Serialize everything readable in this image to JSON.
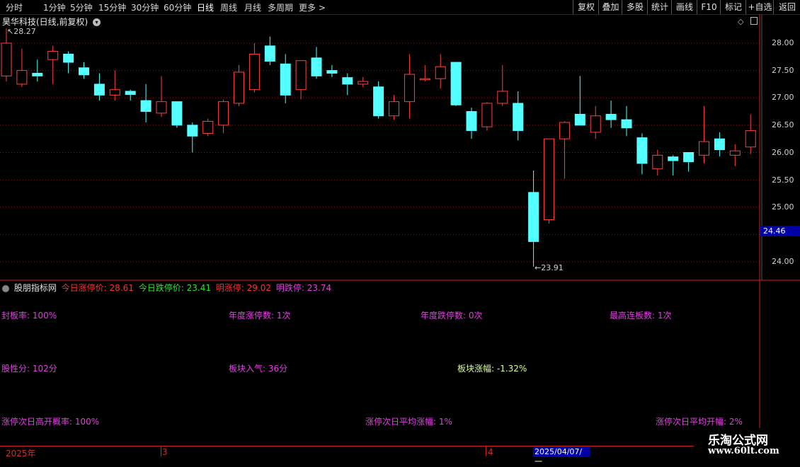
{
  "toolbar": {
    "periods": [
      "分时",
      "1分钟",
      "5分钟",
      "15分钟",
      "30分钟",
      "60分钟",
      "日线",
      "周线",
      "月线",
      "多周期",
      "更多"
    ],
    "active_period": "日线",
    "right_buttons": [
      "复权",
      "叠加",
      "多股",
      "统计",
      "画线",
      "F10",
      "标记",
      "+自选",
      "返回"
    ]
  },
  "chart": {
    "title": "昊华科技(日线,前复权)",
    "high_label": "28.27",
    "low_label": "23.91",
    "current_price": "24.46",
    "y_ticks": [
      "28.00",
      "27.50",
      "27.00",
      "26.50",
      "26.00",
      "25.50",
      "25.00",
      "24.00"
    ],
    "colors": {
      "up": "#ff4040",
      "down": "#54ffff",
      "grid": "#8b1a1a"
    }
  },
  "indicator": {
    "name": "股朋指标网",
    "limit_up_label": "今日涨停价:",
    "limit_up_value": "28.61",
    "limit_down_label": "今日跌停价:",
    "limit_down_value": "23.41",
    "tmr_up_label": "明涨停:",
    "tmr_up_value": "29.02",
    "tmr_down_label": "明跌停:",
    "tmr_down_value": "23.74",
    "rows": [
      [
        "封板率: 100%",
        "年度涨停数: 1次",
        "年度跌停数: 0次",
        "最高连板数: 1次"
      ],
      [
        "股性分: 102分",
        "板块入气: 36分",
        "板块涨幅: -1.32%"
      ],
      [
        "涨停次日高开概率: 100%",
        "涨停次日平均涨幅: 1%",
        "涨停次日平均开幅: 2%"
      ]
    ]
  },
  "timeline": {
    "labels": [
      "2025年",
      "3",
      "4"
    ],
    "current": "2025/04/07/一"
  },
  "watermark": {
    "title": "乐淘公式网",
    "url": "www.60lt.com"
  },
  "chart_data": {
    "type": "candlestick",
    "ylim": [
      23.8,
      28.4
    ],
    "candles": [
      {
        "o": 27.4,
        "h": 28.27,
        "l": 27.3,
        "c": 28.0
      },
      {
        "o": 27.25,
        "h": 27.9,
        "l": 27.2,
        "c": 27.5
      },
      {
        "o": 27.45,
        "h": 27.7,
        "l": 27.3,
        "c": 27.4
      },
      {
        "o": 27.7,
        "h": 27.95,
        "l": 27.25,
        "c": 27.85
      },
      {
        "o": 27.8,
        "h": 27.85,
        "l": 27.45,
        "c": 27.65
      },
      {
        "o": 27.55,
        "h": 27.65,
        "l": 27.35,
        "c": 27.42
      },
      {
        "o": 27.25,
        "h": 27.45,
        "l": 26.95,
        "c": 27.05
      },
      {
        "o": 27.05,
        "h": 27.5,
        "l": 26.95,
        "c": 27.15
      },
      {
        "o": 27.12,
        "h": 27.15,
        "l": 26.95,
        "c": 27.06
      },
      {
        "o": 26.95,
        "h": 27.25,
        "l": 26.55,
        "c": 26.75
      },
      {
        "o": 26.72,
        "h": 27.4,
        "l": 26.65,
        "c": 26.93
      },
      {
        "o": 26.93,
        "h": 26.93,
        "l": 26.45,
        "c": 26.5
      },
      {
        "o": 26.5,
        "h": 26.55,
        "l": 26.0,
        "c": 26.3
      },
      {
        "o": 26.35,
        "h": 26.62,
        "l": 26.3,
        "c": 26.57
      },
      {
        "o": 26.5,
        "h": 26.97,
        "l": 26.35,
        "c": 26.93
      },
      {
        "o": 26.9,
        "h": 27.6,
        "l": 26.85,
        "c": 27.47
      },
      {
        "o": 27.15,
        "h": 28.0,
        "l": 27.1,
        "c": 27.8
      },
      {
        "o": 27.95,
        "h": 28.12,
        "l": 27.6,
        "c": 27.67
      },
      {
        "o": 27.62,
        "h": 27.8,
        "l": 26.9,
        "c": 27.05
      },
      {
        "o": 27.15,
        "h": 27.65,
        "l": 26.97,
        "c": 27.68
      },
      {
        "o": 27.73,
        "h": 27.93,
        "l": 27.35,
        "c": 27.4
      },
      {
        "o": 27.5,
        "h": 27.6,
        "l": 27.38,
        "c": 27.45
      },
      {
        "o": 27.37,
        "h": 27.45,
        "l": 27.05,
        "c": 27.25
      },
      {
        "o": 27.25,
        "h": 27.38,
        "l": 27.2,
        "c": 27.3
      },
      {
        "o": 27.2,
        "h": 27.3,
        "l": 26.62,
        "c": 26.67
      },
      {
        "o": 26.67,
        "h": 27.05,
        "l": 26.6,
        "c": 26.93
      },
      {
        "o": 26.93,
        "h": 27.8,
        "l": 26.62,
        "c": 27.43
      },
      {
        "o": 27.33,
        "h": 27.6,
        "l": 27.3,
        "c": 27.35
      },
      {
        "o": 27.35,
        "h": 27.8,
        "l": 27.17,
        "c": 27.57
      },
      {
        "o": 27.65,
        "h": 27.65,
        "l": 26.85,
        "c": 26.87
      },
      {
        "o": 26.75,
        "h": 26.82,
        "l": 26.25,
        "c": 26.4
      },
      {
        "o": 26.47,
        "h": 26.92,
        "l": 26.4,
        "c": 26.9
      },
      {
        "o": 26.9,
        "h": 27.6,
        "l": 26.85,
        "c": 27.12
      },
      {
        "o": 26.9,
        "h": 27.12,
        "l": 26.22,
        "c": 26.4
      },
      {
        "o": 25.27,
        "h": 25.67,
        "l": 23.91,
        "c": 24.37
      },
      {
        "o": 24.77,
        "h": 26.25,
        "l": 24.7,
        "c": 26.25
      },
      {
        "o": 26.25,
        "h": 26.57,
        "l": 25.52,
        "c": 26.55
      },
      {
        "o": 26.7,
        "h": 27.4,
        "l": 26.5,
        "c": 26.5
      },
      {
        "o": 26.37,
        "h": 26.85,
        "l": 26.25,
        "c": 26.67
      },
      {
        "o": 26.7,
        "h": 26.95,
        "l": 26.45,
        "c": 26.6
      },
      {
        "o": 26.6,
        "h": 26.85,
        "l": 26.3,
        "c": 26.45
      },
      {
        "o": 26.27,
        "h": 26.35,
        "l": 25.6,
        "c": 25.8
      },
      {
        "o": 25.7,
        "h": 26.05,
        "l": 25.58,
        "c": 25.95
      },
      {
        "o": 25.92,
        "h": 25.95,
        "l": 25.58,
        "c": 25.85
      },
      {
        "o": 26.0,
        "h": 26.0,
        "l": 25.65,
        "c": 25.83
      },
      {
        "o": 25.95,
        "h": 26.85,
        "l": 25.8,
        "c": 26.2
      },
      {
        "o": 26.25,
        "h": 26.37,
        "l": 25.93,
        "c": 26.05
      },
      {
        "o": 25.95,
        "h": 26.15,
        "l": 25.75,
        "c": 26.03
      },
      {
        "o": 26.1,
        "h": 26.7,
        "l": 25.97,
        "c": 26.4
      }
    ]
  }
}
